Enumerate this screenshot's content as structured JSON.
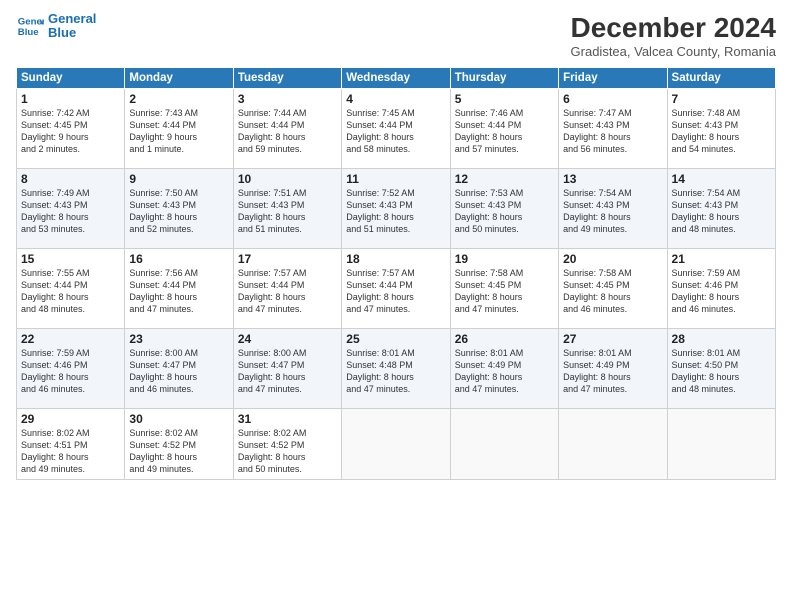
{
  "header": {
    "logo_line1": "General",
    "logo_line2": "Blue",
    "month_title": "December 2024",
    "subtitle": "Gradistea, Valcea County, Romania"
  },
  "days_of_week": [
    "Sunday",
    "Monday",
    "Tuesday",
    "Wednesday",
    "Thursday",
    "Friday",
    "Saturday"
  ],
  "weeks": [
    [
      {
        "day": "1",
        "lines": [
          "Sunrise: 7:42 AM",
          "Sunset: 4:45 PM",
          "Daylight: 9 hours",
          "and 2 minutes."
        ]
      },
      {
        "day": "2",
        "lines": [
          "Sunrise: 7:43 AM",
          "Sunset: 4:44 PM",
          "Daylight: 9 hours",
          "and 1 minute."
        ]
      },
      {
        "day": "3",
        "lines": [
          "Sunrise: 7:44 AM",
          "Sunset: 4:44 PM",
          "Daylight: 8 hours",
          "and 59 minutes."
        ]
      },
      {
        "day": "4",
        "lines": [
          "Sunrise: 7:45 AM",
          "Sunset: 4:44 PM",
          "Daylight: 8 hours",
          "and 58 minutes."
        ]
      },
      {
        "day": "5",
        "lines": [
          "Sunrise: 7:46 AM",
          "Sunset: 4:44 PM",
          "Daylight: 8 hours",
          "and 57 minutes."
        ]
      },
      {
        "day": "6",
        "lines": [
          "Sunrise: 7:47 AM",
          "Sunset: 4:43 PM",
          "Daylight: 8 hours",
          "and 56 minutes."
        ]
      },
      {
        "day": "7",
        "lines": [
          "Sunrise: 7:48 AM",
          "Sunset: 4:43 PM",
          "Daylight: 8 hours",
          "and 54 minutes."
        ]
      }
    ],
    [
      {
        "day": "8",
        "lines": [
          "Sunrise: 7:49 AM",
          "Sunset: 4:43 PM",
          "Daylight: 8 hours",
          "and 53 minutes."
        ]
      },
      {
        "day": "9",
        "lines": [
          "Sunrise: 7:50 AM",
          "Sunset: 4:43 PM",
          "Daylight: 8 hours",
          "and 52 minutes."
        ]
      },
      {
        "day": "10",
        "lines": [
          "Sunrise: 7:51 AM",
          "Sunset: 4:43 PM",
          "Daylight: 8 hours",
          "and 51 minutes."
        ]
      },
      {
        "day": "11",
        "lines": [
          "Sunrise: 7:52 AM",
          "Sunset: 4:43 PM",
          "Daylight: 8 hours",
          "and 51 minutes."
        ]
      },
      {
        "day": "12",
        "lines": [
          "Sunrise: 7:53 AM",
          "Sunset: 4:43 PM",
          "Daylight: 8 hours",
          "and 50 minutes."
        ]
      },
      {
        "day": "13",
        "lines": [
          "Sunrise: 7:54 AM",
          "Sunset: 4:43 PM",
          "Daylight: 8 hours",
          "and 49 minutes."
        ]
      },
      {
        "day": "14",
        "lines": [
          "Sunrise: 7:54 AM",
          "Sunset: 4:43 PM",
          "Daylight: 8 hours",
          "and 48 minutes."
        ]
      }
    ],
    [
      {
        "day": "15",
        "lines": [
          "Sunrise: 7:55 AM",
          "Sunset: 4:44 PM",
          "Daylight: 8 hours",
          "and 48 minutes."
        ]
      },
      {
        "day": "16",
        "lines": [
          "Sunrise: 7:56 AM",
          "Sunset: 4:44 PM",
          "Daylight: 8 hours",
          "and 47 minutes."
        ]
      },
      {
        "day": "17",
        "lines": [
          "Sunrise: 7:57 AM",
          "Sunset: 4:44 PM",
          "Daylight: 8 hours",
          "and 47 minutes."
        ]
      },
      {
        "day": "18",
        "lines": [
          "Sunrise: 7:57 AM",
          "Sunset: 4:44 PM",
          "Daylight: 8 hours",
          "and 47 minutes."
        ]
      },
      {
        "day": "19",
        "lines": [
          "Sunrise: 7:58 AM",
          "Sunset: 4:45 PM",
          "Daylight: 8 hours",
          "and 47 minutes."
        ]
      },
      {
        "day": "20",
        "lines": [
          "Sunrise: 7:58 AM",
          "Sunset: 4:45 PM",
          "Daylight: 8 hours",
          "and 46 minutes."
        ]
      },
      {
        "day": "21",
        "lines": [
          "Sunrise: 7:59 AM",
          "Sunset: 4:46 PM",
          "Daylight: 8 hours",
          "and 46 minutes."
        ]
      }
    ],
    [
      {
        "day": "22",
        "lines": [
          "Sunrise: 7:59 AM",
          "Sunset: 4:46 PM",
          "Daylight: 8 hours",
          "and 46 minutes."
        ]
      },
      {
        "day": "23",
        "lines": [
          "Sunrise: 8:00 AM",
          "Sunset: 4:47 PM",
          "Daylight: 8 hours",
          "and 46 minutes."
        ]
      },
      {
        "day": "24",
        "lines": [
          "Sunrise: 8:00 AM",
          "Sunset: 4:47 PM",
          "Daylight: 8 hours",
          "and 47 minutes."
        ]
      },
      {
        "day": "25",
        "lines": [
          "Sunrise: 8:01 AM",
          "Sunset: 4:48 PM",
          "Daylight: 8 hours",
          "and 47 minutes."
        ]
      },
      {
        "day": "26",
        "lines": [
          "Sunrise: 8:01 AM",
          "Sunset: 4:49 PM",
          "Daylight: 8 hours",
          "and 47 minutes."
        ]
      },
      {
        "day": "27",
        "lines": [
          "Sunrise: 8:01 AM",
          "Sunset: 4:49 PM",
          "Daylight: 8 hours",
          "and 47 minutes."
        ]
      },
      {
        "day": "28",
        "lines": [
          "Sunrise: 8:01 AM",
          "Sunset: 4:50 PM",
          "Daylight: 8 hours",
          "and 48 minutes."
        ]
      }
    ],
    [
      {
        "day": "29",
        "lines": [
          "Sunrise: 8:02 AM",
          "Sunset: 4:51 PM",
          "Daylight: 8 hours",
          "and 49 minutes."
        ]
      },
      {
        "day": "30",
        "lines": [
          "Sunrise: 8:02 AM",
          "Sunset: 4:52 PM",
          "Daylight: 8 hours",
          "and 49 minutes."
        ]
      },
      {
        "day": "31",
        "lines": [
          "Sunrise: 8:02 AM",
          "Sunset: 4:52 PM",
          "Daylight: 8 hours",
          "and 50 minutes."
        ]
      },
      {
        "day": "",
        "lines": []
      },
      {
        "day": "",
        "lines": []
      },
      {
        "day": "",
        "lines": []
      },
      {
        "day": "",
        "lines": []
      }
    ]
  ]
}
